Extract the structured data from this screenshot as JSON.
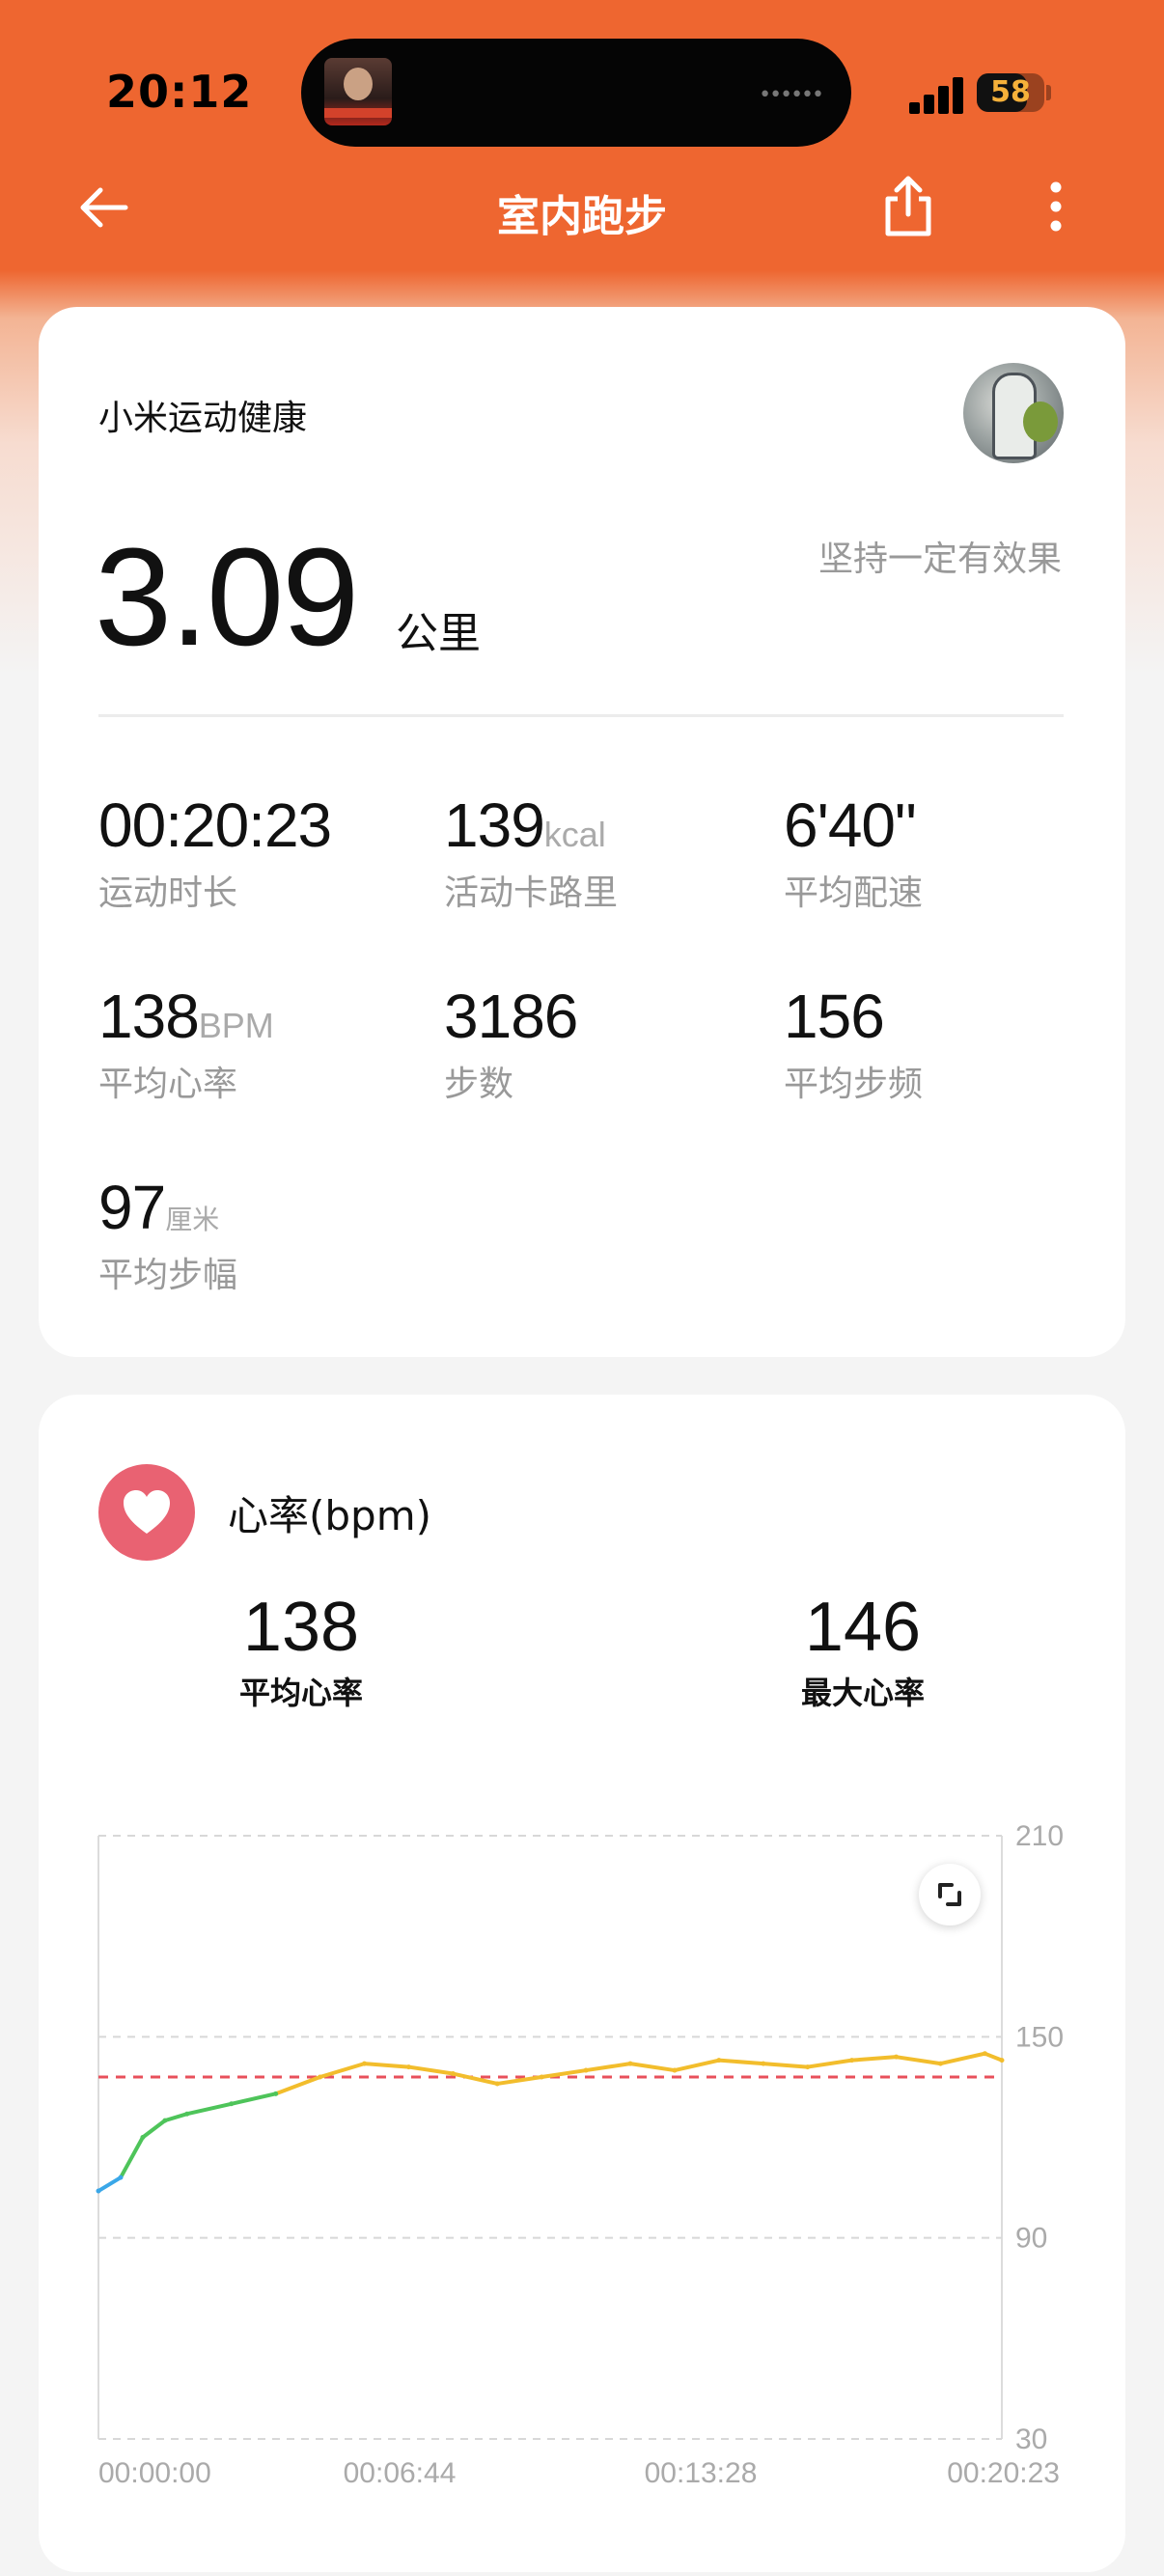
{
  "status_bar": {
    "time": "20:12",
    "battery": "58"
  },
  "nav": {
    "title": "室内跑步",
    "back_icon": "arrow-left-icon",
    "share_icon": "share-icon",
    "more_icon": "more-vertical-icon"
  },
  "summary": {
    "brand": "小米运动健康",
    "slogan": "坚持一定有效果",
    "distance": "3.09",
    "distance_unit": "公里",
    "stats": [
      {
        "value": "00:20:23",
        "unit": "",
        "label": "运动时长"
      },
      {
        "value": "139",
        "unit": "kcal",
        "label": "活动卡路里"
      },
      {
        "value": "6'40\"",
        "unit": "",
        "label": "平均配速"
      },
      {
        "value": "138",
        "unit": "BPM",
        "label": "平均心率"
      },
      {
        "value": "3186",
        "unit": "",
        "label": "步数"
      },
      {
        "value": "156",
        "unit": "",
        "label": "平均步频"
      },
      {
        "value": "97",
        "unit": "厘米",
        "label": "平均步幅"
      }
    ]
  },
  "heart_rate": {
    "title": "心率(bpm)",
    "avg_value": "138",
    "avg_label": "平均心率",
    "max_value": "146",
    "max_label": "最大心率",
    "colors": {
      "accent": "#e96272",
      "line_blue": "#3aa7e8",
      "line_green": "#4ec45a",
      "line_yellow": "#f2bd2c",
      "avg_line": "#e8505b"
    }
  },
  "chart_data": {
    "type": "line",
    "title": "",
    "xlabel": "",
    "ylabel": "",
    "ylim": [
      30,
      210
    ],
    "yticks": [
      "210",
      "150",
      "90",
      "30"
    ],
    "xticks": [
      "00:00:00",
      "00:06:44",
      "00:13:28",
      "00:20:23"
    ],
    "average_line": 138,
    "grid": "dashed horizontal",
    "series": [
      {
        "x_seconds": [
          0,
          30,
          60,
          90,
          120,
          180,
          240,
          300,
          360,
          420,
          480,
          540,
          600,
          660,
          720,
          780,
          840,
          900,
          960,
          1020,
          1080,
          1140,
          1200,
          1223
        ],
        "values": [
          104,
          108,
          120,
          125,
          127,
          130,
          133,
          138,
          142,
          141,
          139,
          136,
          138,
          140,
          142,
          140,
          143,
          142,
          141,
          143,
          144,
          142,
          145,
          143
        ]
      }
    ]
  }
}
